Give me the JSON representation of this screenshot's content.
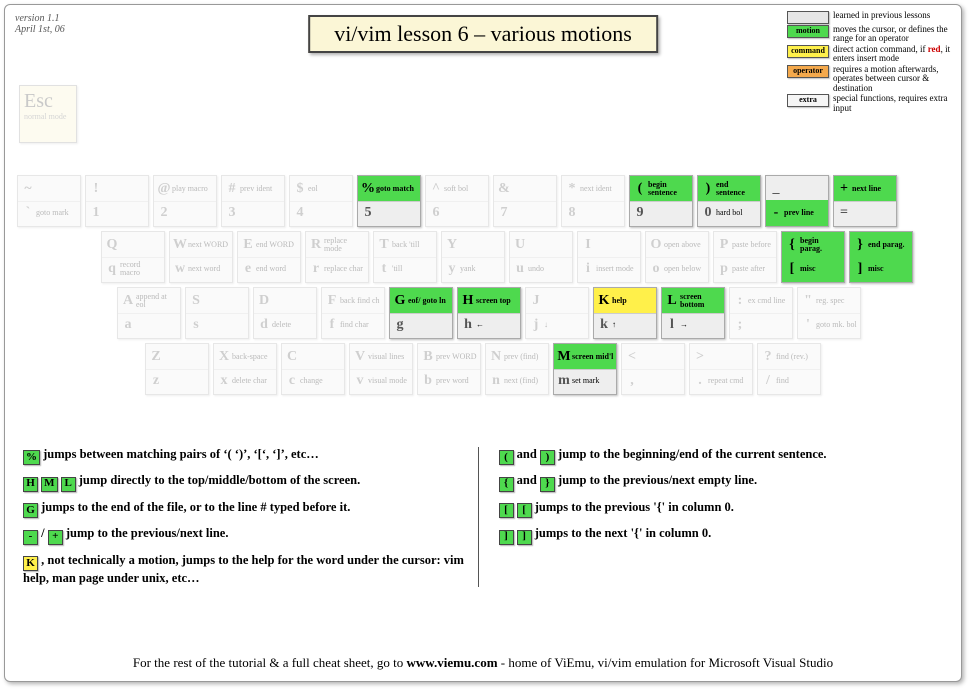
{
  "meta": {
    "version": "version 1.1",
    "date": "April 1st, 06"
  },
  "title": "vi/vim lesson 6 – various motions",
  "legend": {
    "learned": "learned in previous lessons",
    "motion_lbl": "motion",
    "motion": "moves the cursor, or defines the range for an operator",
    "command_lbl": "command",
    "command": "direct action command, if red, it enters insert mode",
    "operator_lbl": "operator",
    "operator": "requires a motion afterwards, operates between cursor & destination",
    "extra_lbl": "extra",
    "extra": "special functions, requires extra input"
  },
  "esc": {
    "big": "Esc",
    "small": "normal mode"
  },
  "row0": {
    "k0": {
      "top": [
        "~",
        ""
      ],
      "bot": [
        "`",
        "goto mark"
      ]
    },
    "k1": {
      "top": [
        "!",
        ""
      ],
      "bot": [
        "1",
        ""
      ]
    },
    "k2": {
      "top": [
        "@",
        "play macro"
      ],
      "bot": [
        "2",
        ""
      ]
    },
    "k3": {
      "top": [
        "#",
        "prev ident"
      ],
      "bot": [
        "3",
        ""
      ]
    },
    "k4": {
      "top": [
        "$",
        "eol"
      ],
      "bot": [
        "4",
        ""
      ]
    },
    "k5": {
      "top": [
        "%",
        "goto match"
      ],
      "bot": [
        "5",
        ""
      ]
    },
    "k6": {
      "top": [
        "^",
        "soft bol"
      ],
      "bot": [
        "6",
        ""
      ]
    },
    "k7": {
      "top": [
        "&",
        ""
      ],
      "bot": [
        "7",
        ""
      ]
    },
    "k8": {
      "top": [
        "*",
        "next ident"
      ],
      "bot": [
        "8",
        ""
      ]
    },
    "k9": {
      "top": [
        "(",
        "begin sentence"
      ],
      "bot": [
        "9",
        ""
      ]
    },
    "k10": {
      "top": [
        ")",
        "end sentence"
      ],
      "bot": [
        "0",
        "hard bol"
      ]
    },
    "k11": {
      "top": [
        "_",
        ""
      ],
      "bot": [
        "-",
        "prev line"
      ]
    },
    "k12": {
      "top": [
        "+",
        "next line"
      ],
      "bot": [
        "=",
        ""
      ]
    }
  },
  "row1": {
    "k0": {
      "top": [
        "Q",
        ""
      ],
      "bot": [
        "q",
        "record macro"
      ]
    },
    "k1": {
      "top": [
        "W",
        "next WORD"
      ],
      "bot": [
        "w",
        "next word"
      ]
    },
    "k2": {
      "top": [
        "E",
        "end WORD"
      ],
      "bot": [
        "e",
        "end word"
      ]
    },
    "k3": {
      "top": [
        "R",
        "replace mode"
      ],
      "bot": [
        "r",
        "replace char"
      ]
    },
    "k4": {
      "top": [
        "T",
        "back 'till"
      ],
      "bot": [
        "t",
        "'till"
      ]
    },
    "k5": {
      "top": [
        "Y",
        ""
      ],
      "bot": [
        "y",
        "yank"
      ]
    },
    "k6": {
      "top": [
        "U",
        ""
      ],
      "bot": [
        "u",
        "undo"
      ]
    },
    "k7": {
      "top": [
        "I",
        ""
      ],
      "bot": [
        "i",
        "insert mode"
      ]
    },
    "k8": {
      "top": [
        "O",
        "open above"
      ],
      "bot": [
        "o",
        "open below"
      ]
    },
    "k9": {
      "top": [
        "P",
        "paste before"
      ],
      "bot": [
        "p",
        "paste after"
      ]
    },
    "k10": {
      "top": [
        "{",
        "begin parag."
      ],
      "bot": [
        "[",
        "misc"
      ]
    },
    "k11": {
      "top": [
        "}",
        "end parag."
      ],
      "bot": [
        "]",
        "misc"
      ]
    }
  },
  "row2": {
    "k0": {
      "top": [
        "A",
        "append at eol"
      ],
      "bot": [
        "a",
        ""
      ]
    },
    "k1": {
      "top": [
        "S",
        ""
      ],
      "bot": [
        "s",
        ""
      ]
    },
    "k2": {
      "top": [
        "D",
        ""
      ],
      "bot": [
        "d",
        "delete"
      ]
    },
    "k3": {
      "top": [
        "F",
        "back find ch"
      ],
      "bot": [
        "f",
        "find char"
      ]
    },
    "k4": {
      "top": [
        "G",
        "eof/ goto ln"
      ],
      "bot": [
        "g",
        ""
      ]
    },
    "k5": {
      "top": [
        "H",
        "screen top"
      ],
      "bot": [
        "h",
        "←"
      ]
    },
    "k6": {
      "top": [
        "J",
        ""
      ],
      "bot": [
        "j",
        "↓"
      ]
    },
    "k7": {
      "top": [
        "K",
        "help"
      ],
      "bot": [
        "k",
        "↑"
      ]
    },
    "k8": {
      "top": [
        "L",
        "screen bottom"
      ],
      "bot": [
        "l",
        "→"
      ]
    },
    "k9": {
      "top": [
        ":",
        "ex cmd line"
      ],
      "bot": [
        ";",
        ""
      ]
    },
    "k10": {
      "top": [
        "\"",
        "reg. spec"
      ],
      "bot": [
        "'",
        "goto mk. bol"
      ]
    }
  },
  "row3": {
    "k0": {
      "top": [
        "Z",
        ""
      ],
      "bot": [
        "z",
        ""
      ]
    },
    "k1": {
      "top": [
        "X",
        "back-space"
      ],
      "bot": [
        "x",
        "delete char"
      ]
    },
    "k2": {
      "top": [
        "C",
        ""
      ],
      "bot": [
        "c",
        "change"
      ]
    },
    "k3": {
      "top": [
        "V",
        "visual lines"
      ],
      "bot": [
        "v",
        "visual mode"
      ]
    },
    "k4": {
      "top": [
        "B",
        "prev WORD"
      ],
      "bot": [
        "b",
        "prev word"
      ]
    },
    "k5": {
      "top": [
        "N",
        "prev (find)"
      ],
      "bot": [
        "n",
        "next (find)"
      ]
    },
    "k6": {
      "top": [
        "M",
        "screen mid'l"
      ],
      "bot": [
        "m",
        "set mark"
      ]
    },
    "k7": {
      "top": [
        "<",
        ""
      ],
      "bot": [
        ",",
        ""
      ]
    },
    "k8": {
      "top": [
        ">",
        ""
      ],
      "bot": [
        ".",
        "repeat cmd"
      ]
    },
    "k9": {
      "top": [
        "?",
        "find (rev.)"
      ],
      "bot": [
        "/",
        "find"
      ]
    }
  },
  "notes": {
    "left": [
      {
        "chips": [
          [
            "%",
            "motion"
          ]
        ],
        "text": " jumps between matching pairs of ‘( ‘)’, ‘[‘, ‘]’,  etc…"
      },
      {
        "chips": [
          [
            "H",
            "motion"
          ],
          [
            "M",
            "motion"
          ],
          [
            "L",
            "motion"
          ]
        ],
        "text": " jump directly to the top/middle/bottom of the screen."
      },
      {
        "chips": [
          [
            "G",
            "motion"
          ]
        ],
        "text": " jumps to the end of the file, or to the line # typed before it."
      },
      {
        "chips": [
          [
            "-",
            "motion"
          ]
        ],
        "text2": " / ",
        "chips2": [
          [
            "+",
            "motion"
          ]
        ],
        "text3": " jump to the previous/next line."
      },
      {
        "chips": [
          [
            "K",
            "command"
          ]
        ],
        "text": ", not technically a motion, jumps to the help for the word under the cursor: vim help, man page under unix, etc…"
      }
    ],
    "right": [
      {
        "chips": [
          [
            "(",
            "motion"
          ]
        ],
        "text2": " and ",
        "chips2": [
          [
            ")",
            "motion"
          ]
        ],
        "text3": " jump to the beginning/end of the current sentence."
      },
      {
        "chips": [
          [
            "{",
            "motion"
          ]
        ],
        "text2": " and ",
        "chips2": [
          [
            "}",
            "motion"
          ]
        ],
        "text3": " jump to the previous/next empty line."
      },
      {
        "chips": [
          [
            "[",
            "motion"
          ],
          [
            "[",
            "motion"
          ]
        ],
        "text": " jumps to the previous '{' in column 0."
      },
      {
        "chips": [
          [
            "]",
            "motion"
          ],
          [
            "]",
            "motion"
          ]
        ],
        "text": " jumps to the next '{' in column 0."
      }
    ]
  },
  "footer": {
    "pre": "For the rest of the tutorial & a full cheat sheet, go to ",
    "url": "www.viemu.com",
    "post": " - home of ViEmu, vi/vim emulation for Microsoft Visual Studio"
  }
}
